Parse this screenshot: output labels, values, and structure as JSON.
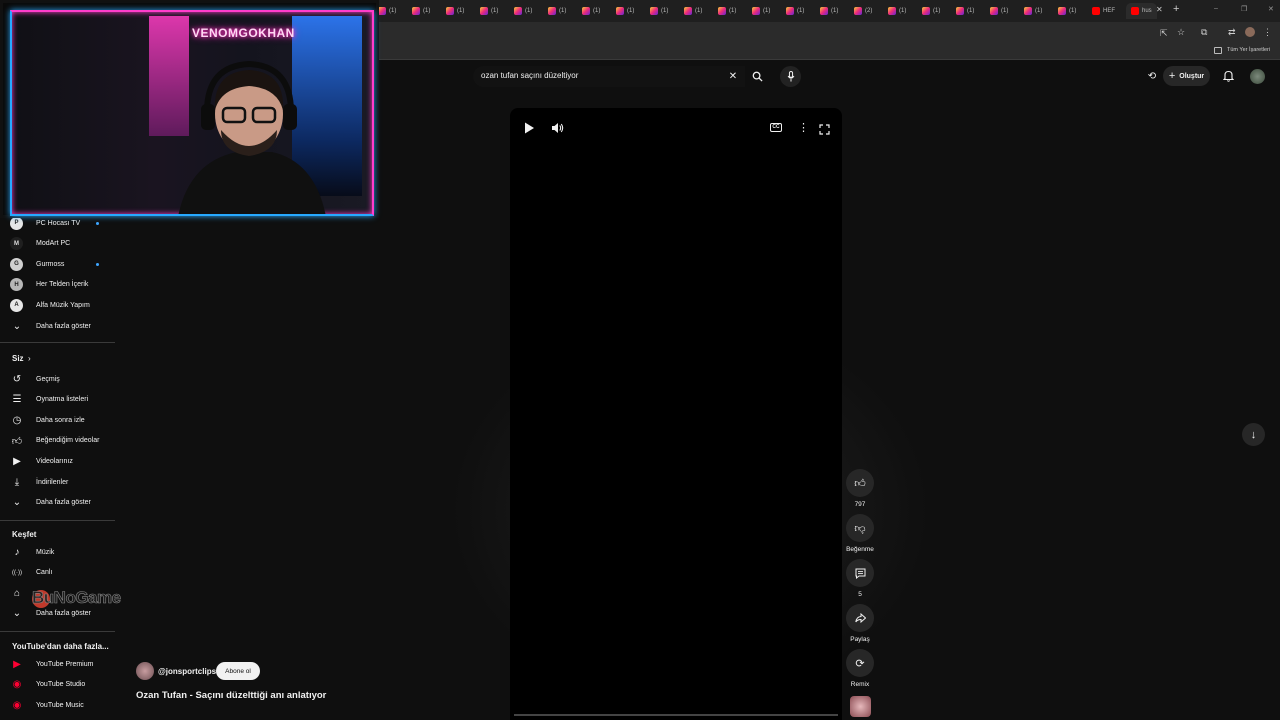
{
  "browser": {
    "tabs": [
      {
        "label": "(1)",
        "icon": "instagram-icon"
      },
      {
        "label": "(1)",
        "icon": "instagram-icon"
      },
      {
        "label": "(1)",
        "icon": "instagram-icon"
      },
      {
        "label": "(1)",
        "icon": "instagram-icon"
      },
      {
        "label": "(1)",
        "icon": "instagram-icon"
      },
      {
        "label": "(1)",
        "icon": "instagram-icon"
      },
      {
        "label": "(1)",
        "icon": "instagram-icon"
      },
      {
        "label": "(1)",
        "icon": "instagram-icon"
      },
      {
        "label": "(1)",
        "icon": "instagram-icon"
      },
      {
        "label": "(1)",
        "icon": "instagram-icon"
      },
      {
        "label": "(1)",
        "icon": "instagram-icon"
      },
      {
        "label": "(1)",
        "icon": "instagram-icon"
      },
      {
        "label": "(1)",
        "icon": "instagram-icon"
      },
      {
        "label": "(1)",
        "icon": "instagram-icon"
      },
      {
        "label": "(2)",
        "icon": "instagram-icon"
      },
      {
        "label": "(1)",
        "icon": "instagram-icon"
      },
      {
        "label": "(1)",
        "icon": "instagram-icon"
      },
      {
        "label": "(1)",
        "icon": "instagram-icon"
      },
      {
        "label": "(1)",
        "icon": "instagram-icon"
      },
      {
        "label": "(1)",
        "icon": "instagram-icon"
      },
      {
        "label": "(1)",
        "icon": "instagram-icon"
      },
      {
        "label": "HEF",
        "icon": "youtube-icon"
      },
      {
        "label": "hus",
        "icon": "youtube-icon"
      }
    ],
    "bookmarks_label": "Tüm Yer İşaretleri",
    "new_tab": "+",
    "close_tab": "✕"
  },
  "webcam": {
    "neon_sign": "VENOMGOKHAN"
  },
  "sidebar": {
    "subscriptions": [
      {
        "label": "PC Hocası TV",
        "avatar": "P",
        "avatar_color": "#e6e6e6",
        "dot": true
      },
      {
        "label": "ModArt PC",
        "avatar": "M",
        "avatar_color": "#1f1f1f",
        "dot": false
      },
      {
        "label": "Gurmoss",
        "avatar": "G",
        "avatar_color": "#d0d0d0",
        "dot": true
      },
      {
        "label": "Her Telden İçerik",
        "avatar": "H",
        "avatar_color": "#b7b7b7",
        "dot": false
      },
      {
        "label": "Alfa Müzik Yapım",
        "avatar": "A",
        "avatar_color": "#e6e6e6",
        "dot": false
      },
      {
        "label": "Daha fazla göster",
        "icon": "chevron-down-icon"
      }
    ],
    "you_heading": "Siz",
    "you_items": [
      {
        "label": "Geçmiş",
        "icon": "history-icon"
      },
      {
        "label": "Oynatma listeleri",
        "icon": "playlist-icon"
      },
      {
        "label": "Daha sonra izle",
        "icon": "clock-icon"
      },
      {
        "label": "Beğendiğim videolar",
        "icon": "thumbs-up-icon"
      },
      {
        "label": "Videolarınız",
        "icon": "video-icon"
      },
      {
        "label": "İndirilenler",
        "icon": "download-icon"
      },
      {
        "label": "Daha fazla göster",
        "icon": "chevron-down-icon"
      }
    ],
    "explore_heading": "Keşfet",
    "explore_items": [
      {
        "label": "Müzik",
        "icon": "music-icon"
      },
      {
        "label": "Canlı",
        "icon": "live-icon"
      },
      {
        "label": "",
        "icon": "gaming-icon"
      },
      {
        "label": "Daha fazla göster",
        "icon": "chevron-down-icon"
      }
    ],
    "more_heading": "YouTube'dan daha fazla...",
    "more_items": [
      {
        "label": "YouTube Premium",
        "icon": "youtube-premium-icon"
      },
      {
        "label": "YouTube Studio",
        "icon": "youtube-studio-icon"
      },
      {
        "label": "YouTube Music",
        "icon": "youtube-music-icon"
      }
    ]
  },
  "header": {
    "search_value": "ozan tufan saçını düzeltiyor",
    "create_label": "Oluştur"
  },
  "actions": {
    "like_count": "797",
    "dislike_label": "Beğenme",
    "comment_count": "5",
    "share_label": "Paylaş",
    "remix_label": "Remix"
  },
  "video": {
    "channel": "@jonsportclips",
    "subscribe_label": "Abone ol",
    "title": "Ozan Tufan - Saçını düzelttiği anı anlatıyor"
  },
  "watermark": "BuNoGame"
}
